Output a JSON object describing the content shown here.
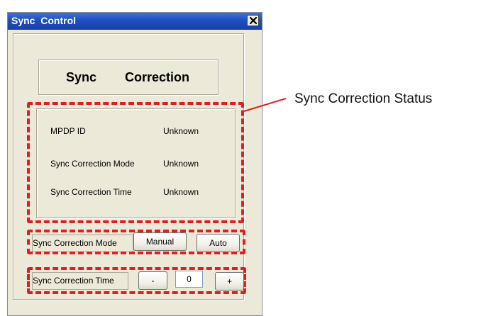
{
  "window": {
    "title": "Sync  Control",
    "close_icon": "close-x-icon"
  },
  "heading": {
    "word1": "Sync",
    "word2": "Correction"
  },
  "status": {
    "rows": [
      {
        "label": "MPDP ID",
        "value": "Unknown"
      },
      {
        "label": "Sync Correction Mode",
        "value": "Unknown"
      },
      {
        "label": "Sync Correction Time",
        "value": "Unknown"
      }
    ]
  },
  "mode_control": {
    "label": "Sync Correction Mode",
    "manual_label": "Manual",
    "auto_label": "Auto"
  },
  "time_control": {
    "label": "Sync Correction Time",
    "decrement_label": "-",
    "value": "0",
    "increment_label": "+"
  },
  "callout": {
    "text": "Sync Correction Status"
  },
  "colors": {
    "highlight": "#e0201e",
    "titlebar": "#1e4fc0",
    "window_bg": "#ece9d8"
  }
}
